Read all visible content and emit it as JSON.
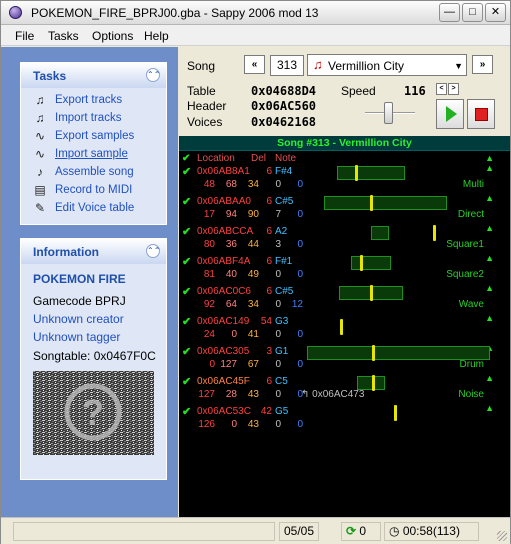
{
  "window": {
    "title": "POKEMON_FIRE_BPRJ00.gba - Sappy 2006 mod 13"
  },
  "menu": [
    "File",
    "Tasks",
    "Options",
    "Help"
  ],
  "tasks": {
    "header": "Tasks",
    "items": [
      {
        "label": "Export tracks",
        "icon": "export-tracks-icon"
      },
      {
        "label": "Import tracks",
        "icon": "import-tracks-icon"
      },
      {
        "label": "Export samples",
        "icon": "export-samples-icon"
      },
      {
        "label": "Import sample",
        "icon": "import-sample-icon"
      },
      {
        "label": "Assemble song",
        "icon": "assemble-song-icon"
      },
      {
        "label": "Record to MIDI",
        "icon": "record-midi-icon"
      },
      {
        "label": "Edit Voice table",
        "icon": "edit-voice-table-icon"
      }
    ]
  },
  "info": {
    "header": "Information",
    "game": "POKEMON FIRE",
    "gamecode": "Gamecode BPRJ",
    "creator": "Unknown creator",
    "tagger": "Unknown tagger",
    "songtable": "Songtable: 0x0467F0C"
  },
  "song": {
    "label": "Song",
    "prev": "«",
    "next": "»",
    "number": "313",
    "name": "Vermillion City",
    "table_label": "Table",
    "table": "0x04688D4",
    "header_label": "Header",
    "header": "0x06AC560",
    "voices_label": "Voices",
    "voices": "0x0462168",
    "speed_label": "Speed",
    "speed": "116"
  },
  "tracks_title": "Song #313 - Vermillion City",
  "columns": {
    "location": "Location",
    "del": "Del",
    "note": "Note"
  },
  "tracks": [
    {
      "loc": "0x06AB8A1",
      "del": "6",
      "note": "F#4",
      "v": [
        "48",
        "68",
        "34",
        "0",
        "0"
      ],
      "type": "Multi",
      "ev": ""
    },
    {
      "loc": "0x06ABAA0",
      "del": "6",
      "note": "C#5",
      "v": [
        "17",
        "94",
        "90",
        "7",
        "0"
      ],
      "type": "Direct",
      "ev": ""
    },
    {
      "loc": "0x06ABCCA",
      "del": "6",
      "note": "A2",
      "v": [
        "80",
        "36",
        "44",
        "3",
        "0"
      ],
      "type": "Square1",
      "ev": ""
    },
    {
      "loc": "0x06ABF4A",
      "del": "6",
      "note": "F#1",
      "v": [
        "81",
        "40",
        "49",
        "0",
        "0"
      ],
      "type": "Square2",
      "ev": ""
    },
    {
      "loc": "0x06AC0C6",
      "del": "6",
      "note": "C#5",
      "v": [
        "92",
        "64",
        "34",
        "0",
        "12"
      ],
      "type": "Wave",
      "ev": ""
    },
    {
      "loc": "0x06AC149",
      "del": "54",
      "note": "G3",
      "v": [
        "24",
        "0",
        "41",
        "0",
        "0"
      ],
      "type": "",
      "ev": ""
    },
    {
      "loc": "0x06AC305",
      "del": "3",
      "note": "G1",
      "v": [
        "0",
        "127",
        "67",
        "0",
        "0"
      ],
      "type": "Drum",
      "ev": ""
    },
    {
      "loc": "0x06AC45F",
      "del": "6",
      "note": "C5",
      "v": [
        "127",
        "28",
        "43",
        "0",
        "0"
      ],
      "type": "Noise",
      "ev": "↰ 0x06AC473"
    },
    {
      "loc": "0x06AC53C",
      "del": "42",
      "note": "G5",
      "v": [
        "126",
        "0",
        "43",
        "0",
        "0"
      ],
      "type": "",
      "ev": ""
    }
  ],
  "status": {
    "pages": "05/05",
    "loops": "0",
    "time": "00:58(113)"
  }
}
